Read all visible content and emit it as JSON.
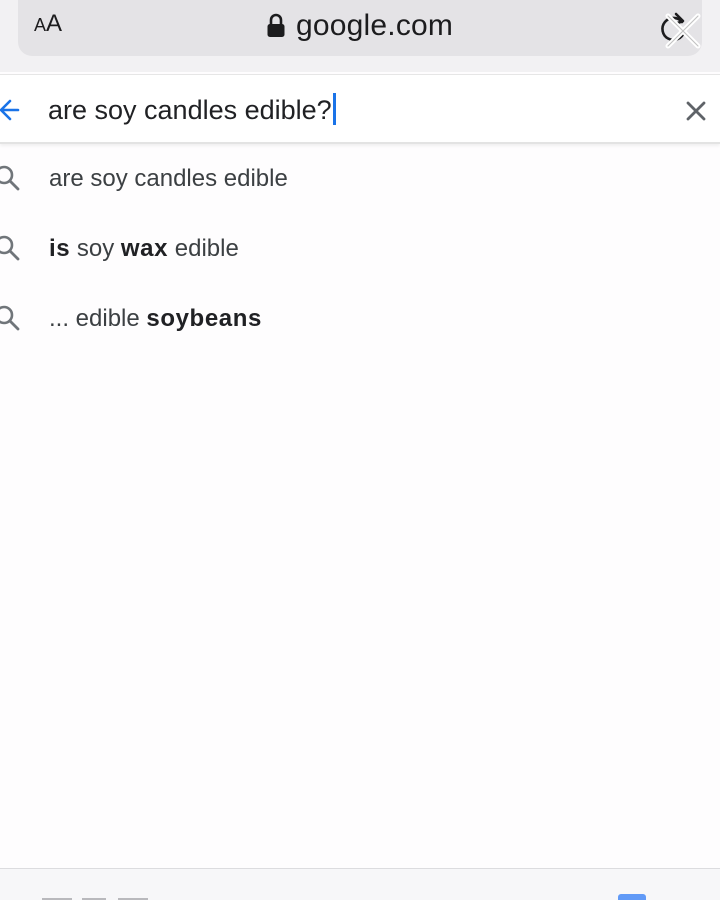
{
  "browser": {
    "text_size_label_small": "A",
    "text_size_label_large": "A",
    "url": "google.com"
  },
  "search": {
    "query": "are soy candles edible?"
  },
  "suggestions": [
    {
      "parts": [
        {
          "text": "are soy candles edible",
          "bold": false
        }
      ]
    },
    {
      "parts": [
        {
          "text": "is",
          "bold": true
        },
        {
          "text": " soy ",
          "bold": false
        },
        {
          "text": "wax",
          "bold": true
        },
        {
          "text": " edible",
          "bold": false
        }
      ]
    },
    {
      "parts": [
        {
          "text": "... edible ",
          "bold": false
        },
        {
          "text": "soybeans",
          "bold": true
        }
      ]
    }
  ],
  "icons": {
    "lock": "lock-icon",
    "reload": "reload-icon",
    "back": "back-arrow-icon",
    "clear": "close-icon",
    "search": "search-icon"
  },
  "colors": {
    "caret": "#1a73e8",
    "back_arrow": "#1a73e8"
  }
}
